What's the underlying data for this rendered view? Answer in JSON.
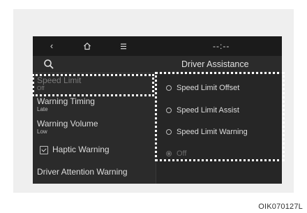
{
  "topbar": {
    "back_icon": "back-icon",
    "home_icon": "home-icon",
    "menu_icon": "menu-icon",
    "clock": "--:--"
  },
  "header": {
    "title": "Driver Assistance",
    "search_icon": "search-icon"
  },
  "left_menu": {
    "speed_limit": {
      "label": "Speed Limit",
      "value": "Off"
    },
    "warning_timing": {
      "label": "Warning Timing",
      "value": "Late"
    },
    "warning_volume": {
      "label": "Warning Volume",
      "value": "Low"
    },
    "haptic_warning": {
      "label": "Haptic Warning",
      "checked": true
    },
    "driver_attention": {
      "label": "Driver Attention Warning"
    }
  },
  "options": [
    {
      "label": "Speed Limit Offset",
      "selected": false
    },
    {
      "label": "Speed Limit Assist",
      "selected": false
    },
    {
      "label": "Speed Limit Warning",
      "selected": false
    },
    {
      "label": "Off",
      "selected": true
    }
  ],
  "figure_code": "OIK070127L"
}
